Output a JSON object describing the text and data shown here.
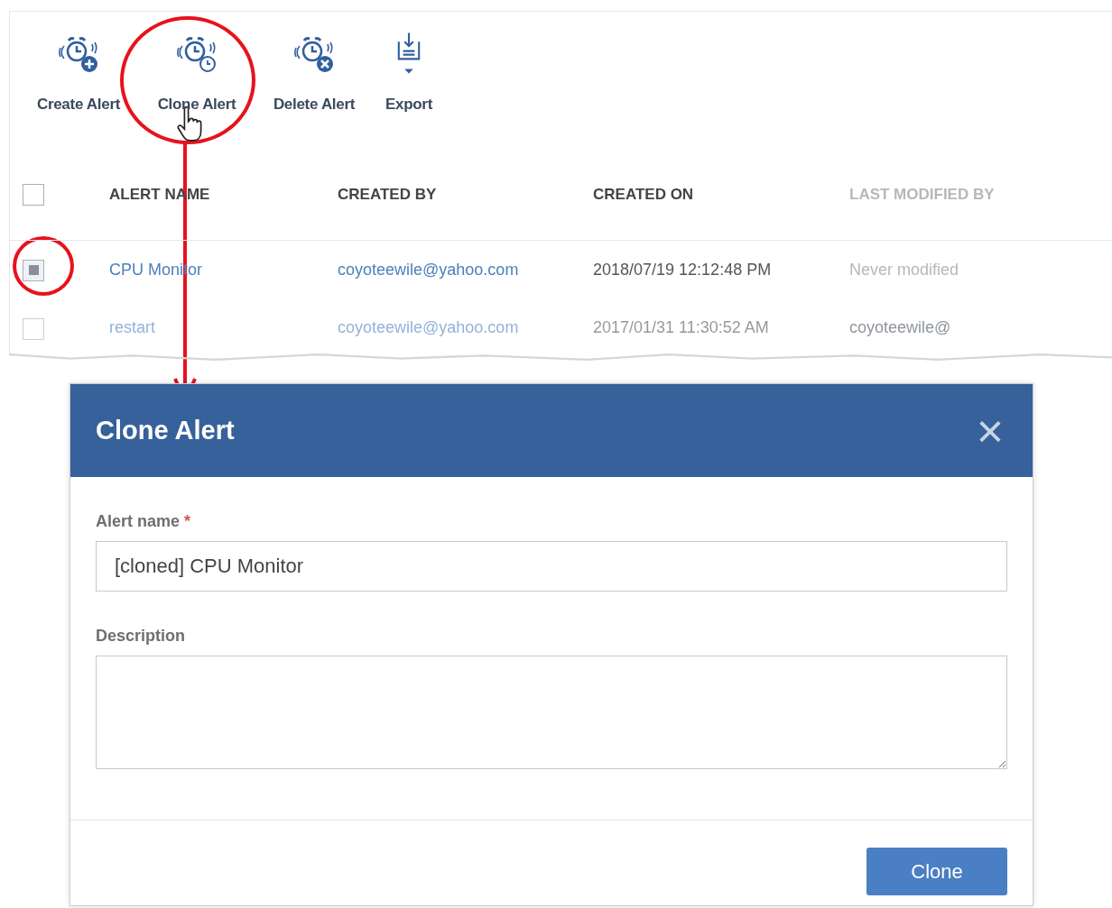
{
  "toolbar": [
    {
      "label": "Create Alert",
      "kind": "create"
    },
    {
      "label": "Clone Alert",
      "kind": "clone"
    },
    {
      "label": "Delete Alert",
      "kind": "delete"
    },
    {
      "label": "Export",
      "kind": "export"
    }
  ],
  "table": {
    "header_checked": false,
    "columns": [
      {
        "label": "ALERT NAME",
        "dimmed": false
      },
      {
        "label": "CREATED BY",
        "dimmed": false
      },
      {
        "label": "CREATED ON",
        "dimmed": false
      },
      {
        "label": "LAST MODIFIED BY",
        "dimmed": true
      }
    ],
    "rows": [
      {
        "checked": true,
        "faded": false,
        "cells": [
          "CPU Monitor",
          "coyoteewile@yahoo.com",
          "2018/07/19 12:12:48 PM",
          "Never modified"
        ]
      },
      {
        "checked": false,
        "faded": true,
        "cells": [
          "restart",
          "coyoteewile@yahoo.com",
          "2017/01/31 11:30:52 AM",
          "coyoteewile@"
        ]
      }
    ]
  },
  "dialog": {
    "title": "Clone Alert",
    "close": "×",
    "fields": [
      {
        "kind": "input",
        "label": "Alert name",
        "required": true,
        "required_mark": "*",
        "value": "[cloned] CPU Monitor"
      },
      {
        "kind": "textarea",
        "label": "Description",
        "required": false
      }
    ],
    "button": "Clone"
  }
}
